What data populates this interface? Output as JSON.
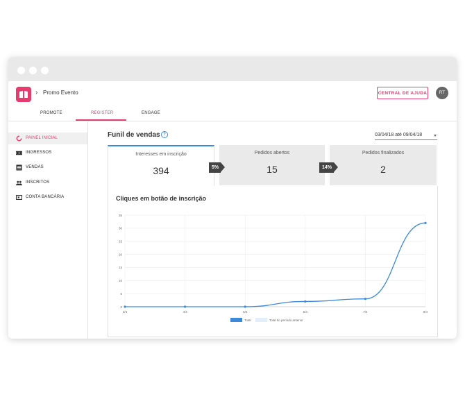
{
  "app": {
    "name": "Promo Evento",
    "help_button": "CENTRAL DE AJUDA",
    "avatar_initials": "RT",
    "brand_color": "#e23d6e"
  },
  "tabs": [
    {
      "label": "PROMOTE"
    },
    {
      "label": "REGISTER"
    },
    {
      "label": "ENGAGE"
    }
  ],
  "sidebar": {
    "items": [
      {
        "label": "PAINEL INICIAL",
        "icon": "dashboard-icon"
      },
      {
        "label": "INGRESSOS",
        "icon": "ticket-icon"
      },
      {
        "label": "VENDAS",
        "icon": "list-icon"
      },
      {
        "label": "INSCRITOS",
        "icon": "people-icon"
      },
      {
        "label": "CONTA BANCÁRIA",
        "icon": "bank-icon"
      }
    ]
  },
  "funnel": {
    "title": "Funil de vendas",
    "date_range": "03/04/18 até 09/04/18",
    "cards": [
      {
        "label": "Interesses em inscrição",
        "value": "394"
      },
      {
        "label": "Pedidos abertos",
        "value": "15"
      },
      {
        "label": "Pedidos finalizados",
        "value": "2"
      }
    ],
    "conversions": [
      "5%",
      "14%"
    ]
  },
  "chart_data": {
    "type": "line",
    "title": "Cliques em botão de inscrição",
    "categories": [
      "3/4",
      "4/4",
      "5/4",
      "6/4",
      "7/4",
      "8/4"
    ],
    "yticks": [
      0,
      5,
      10,
      15,
      20,
      25,
      30,
      35
    ],
    "ylim": [
      0,
      35
    ],
    "grid": true,
    "legend_position": "bottom",
    "series": [
      {
        "name": "Total",
        "values": [
          0,
          0,
          0,
          2,
          3,
          32
        ],
        "color": "#3b8ad9"
      },
      {
        "name": "Total do período anterior",
        "values": [],
        "color": "#e2eef9"
      }
    ]
  }
}
